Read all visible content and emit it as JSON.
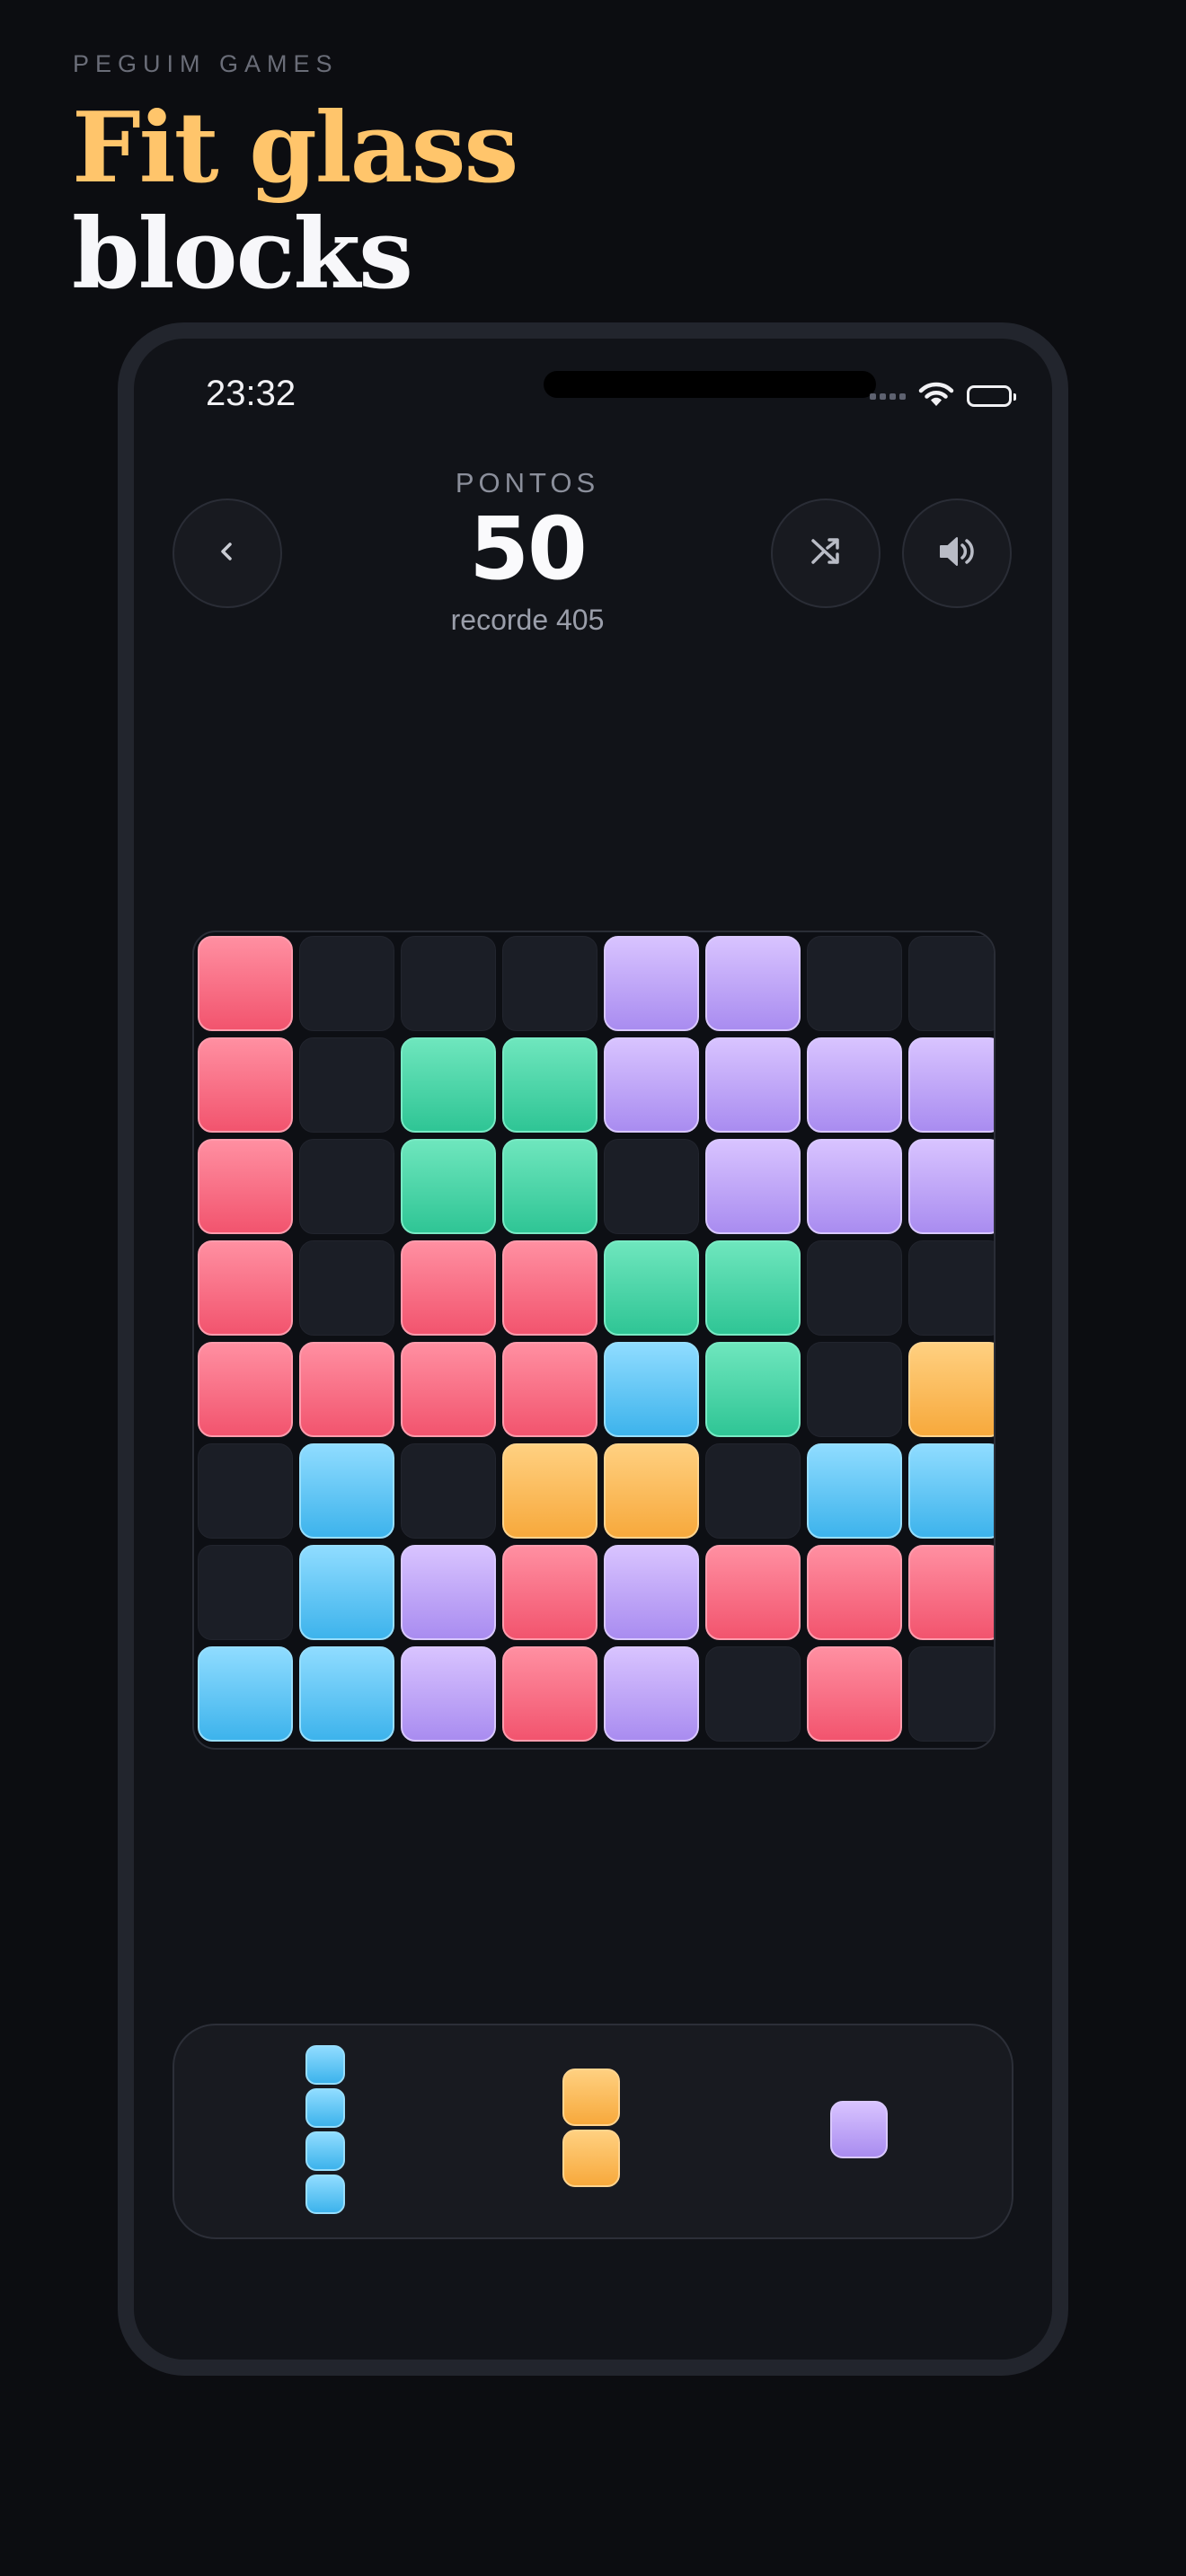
{
  "brand": "PEGUIM GAMES",
  "headline": {
    "line1": "Fit glass",
    "line2": "blocks"
  },
  "status_bar": {
    "time": "23:32",
    "icons": [
      "signal-dots-icon",
      "wifi-icon",
      "battery-icon"
    ]
  },
  "header": {
    "back_icon": "chevron-left-icon",
    "score_label": "PONTOS",
    "score": "50",
    "record": "recorde 405",
    "shuffle_icon": "shuffle-icon",
    "sound_icon": "speaker-icon"
  },
  "colors": {
    "background": "#0c0d11",
    "accent": "#ffc56b",
    "pink": "#f2546e",
    "violet": "#a98cf0",
    "green": "#2fc595",
    "blue": "#3db3ec",
    "orange": "#f7a93c",
    "empty": "#1b1e26"
  },
  "board": {
    "size": 8,
    "legend": {
      ".": "empty",
      "P": "pink",
      "V": "violet",
      "G": "green",
      "B": "blue",
      "O": "orange"
    },
    "rows": [
      "P...VV..",
      "P.GGVVVV",
      "P.GG.VVV",
      "P.PPGG..",
      "PPPPBG.O",
      ".B.OO.BB",
      ".BVPVPPP",
      "BBVPV.P."
    ]
  },
  "tray": {
    "pieces": [
      {
        "color": "blue",
        "shape": "vertical-4"
      },
      {
        "color": "orange",
        "shape": "vertical-2"
      },
      {
        "color": "violet",
        "shape": "single"
      }
    ]
  }
}
